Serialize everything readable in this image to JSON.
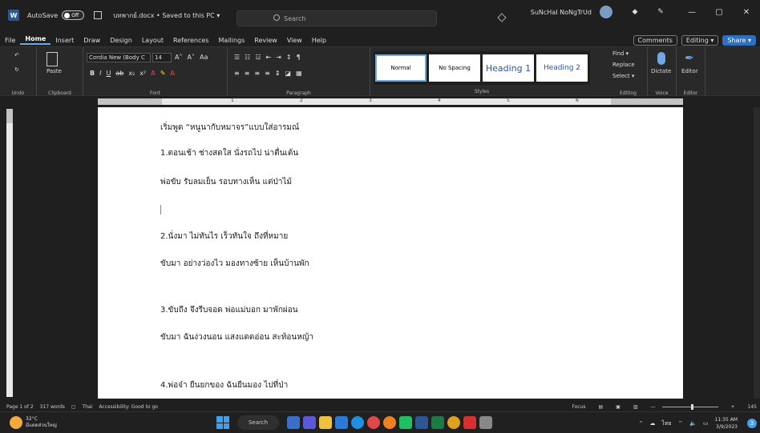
{
  "titlebar": {
    "autosave_label": "AutoSave",
    "autosave_state": "Off",
    "doc_title": "บทพากย์.docx • Saved to this PC ▾",
    "search_placeholder": "Search",
    "user_name": "SuNcHaI NoNgTrUd",
    "win_min": "—",
    "win_max": "▢",
    "win_close": "✕"
  },
  "menu": {
    "tabs": [
      "File",
      "Home",
      "Insert",
      "Draw",
      "Design",
      "Layout",
      "References",
      "Mailings",
      "Review",
      "View",
      "Help"
    ],
    "comments": "Comments",
    "editing": "Editing ▾",
    "share": "Share ▾"
  },
  "ribbon": {
    "undo_label": "Undo",
    "clipboard_label": "Clipboard",
    "paste_label": "Paste",
    "font_name": "Cordia New (Body C",
    "font_size": "14",
    "font_label": "Font",
    "paragraph_label": "Paragraph",
    "styles_label": "Styles",
    "styles": [
      "Normal",
      "No Spacing",
      "Heading 1",
      "Heading 2"
    ],
    "find": "Find ▾",
    "replace": "Replace",
    "select": "Select ▾",
    "editing_label": "Editing",
    "dictate": "Dictate",
    "voice_label": "Voice",
    "editor": "Editor",
    "editor_label": "Editor"
  },
  "ruler": {
    "numbers": [
      "1",
      "2",
      "3",
      "4",
      "5",
      "6"
    ]
  },
  "document": {
    "lines": [
      "เริ่มพูด “หนูนากับหมาจร”แบบใส่อารมณ์",
      "1.ตอนเช้า ช่างสดใส นั่งรถไป น่าตื่นเต้น",
      "พ่อขับ รับลมเย็น รอบทางเห็น แต่ป่าไม้",
      "2.นั่งมา ไม่ทันไร เร็วทันใจ ถึงที่หมาย",
      "ขับมา อย่างว่องไว มองทางซ้าย เห็นบ้านพัก",
      "3.ขับถึง จึงรีบจอด พ่อแม่บอก มาพักผ่อน",
      "ขับมา ฉันง่วงนอน แสงแดดอ่อน สะท้อนหญ้า",
      "4.พ่อจ๋า ยืนยกของ ฉันยืนมอง ไปที่ป่า"
    ]
  },
  "status": {
    "page": "Page 1 of 2",
    "words": "317 words",
    "language": "Thai",
    "accessibility": "Accessibility: Good to go",
    "focus": "Focus",
    "zoom": "145"
  },
  "taskbar": {
    "temperature": "32°C",
    "weather_desc": "มีแดดส่วนใหญ่",
    "search": "Search",
    "lang": "ไทย",
    "time": "11:35 AM",
    "date": "3/9/2023",
    "notif_count": "3"
  }
}
